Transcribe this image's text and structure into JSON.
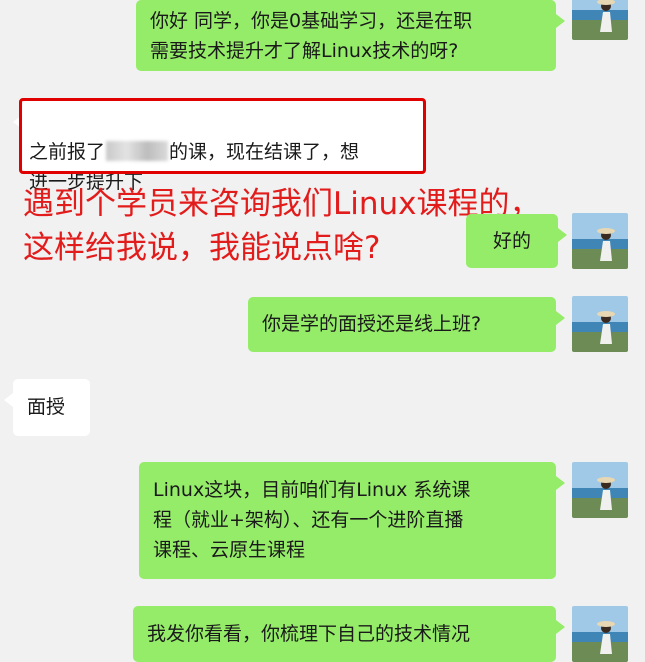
{
  "messages": [
    {
      "text": "你好 同学，你是0基础学习，还是在职\n需要技术提升才了解Linux技术的呀?"
    },
    {
      "text_before": "之前报了",
      "text_after": "的课，现在结课了，想\n进一步提升下"
    },
    {
      "text": "好的"
    },
    {
      "text": "你是学的面授还是线上班?"
    },
    {
      "text": "面授"
    },
    {
      "text": "Linux这块，目前咱们有Linux 系统课\n程（就业+架构）、还有一个进阶直播\n课程、云原生课程"
    },
    {
      "text": "我发你看看，你梳理下自己的技术情况"
    }
  ],
  "overlay_text": "遇到个学员来咨询我们Linux课程的，\n这样给我说，我能说点啥?",
  "colors": {
    "outgoing": "#95ec69",
    "incoming": "#ffffff",
    "annotation": "#e21b1b",
    "background": "#f1f1f1"
  },
  "avatar_icon": "beach-avatar-icon"
}
